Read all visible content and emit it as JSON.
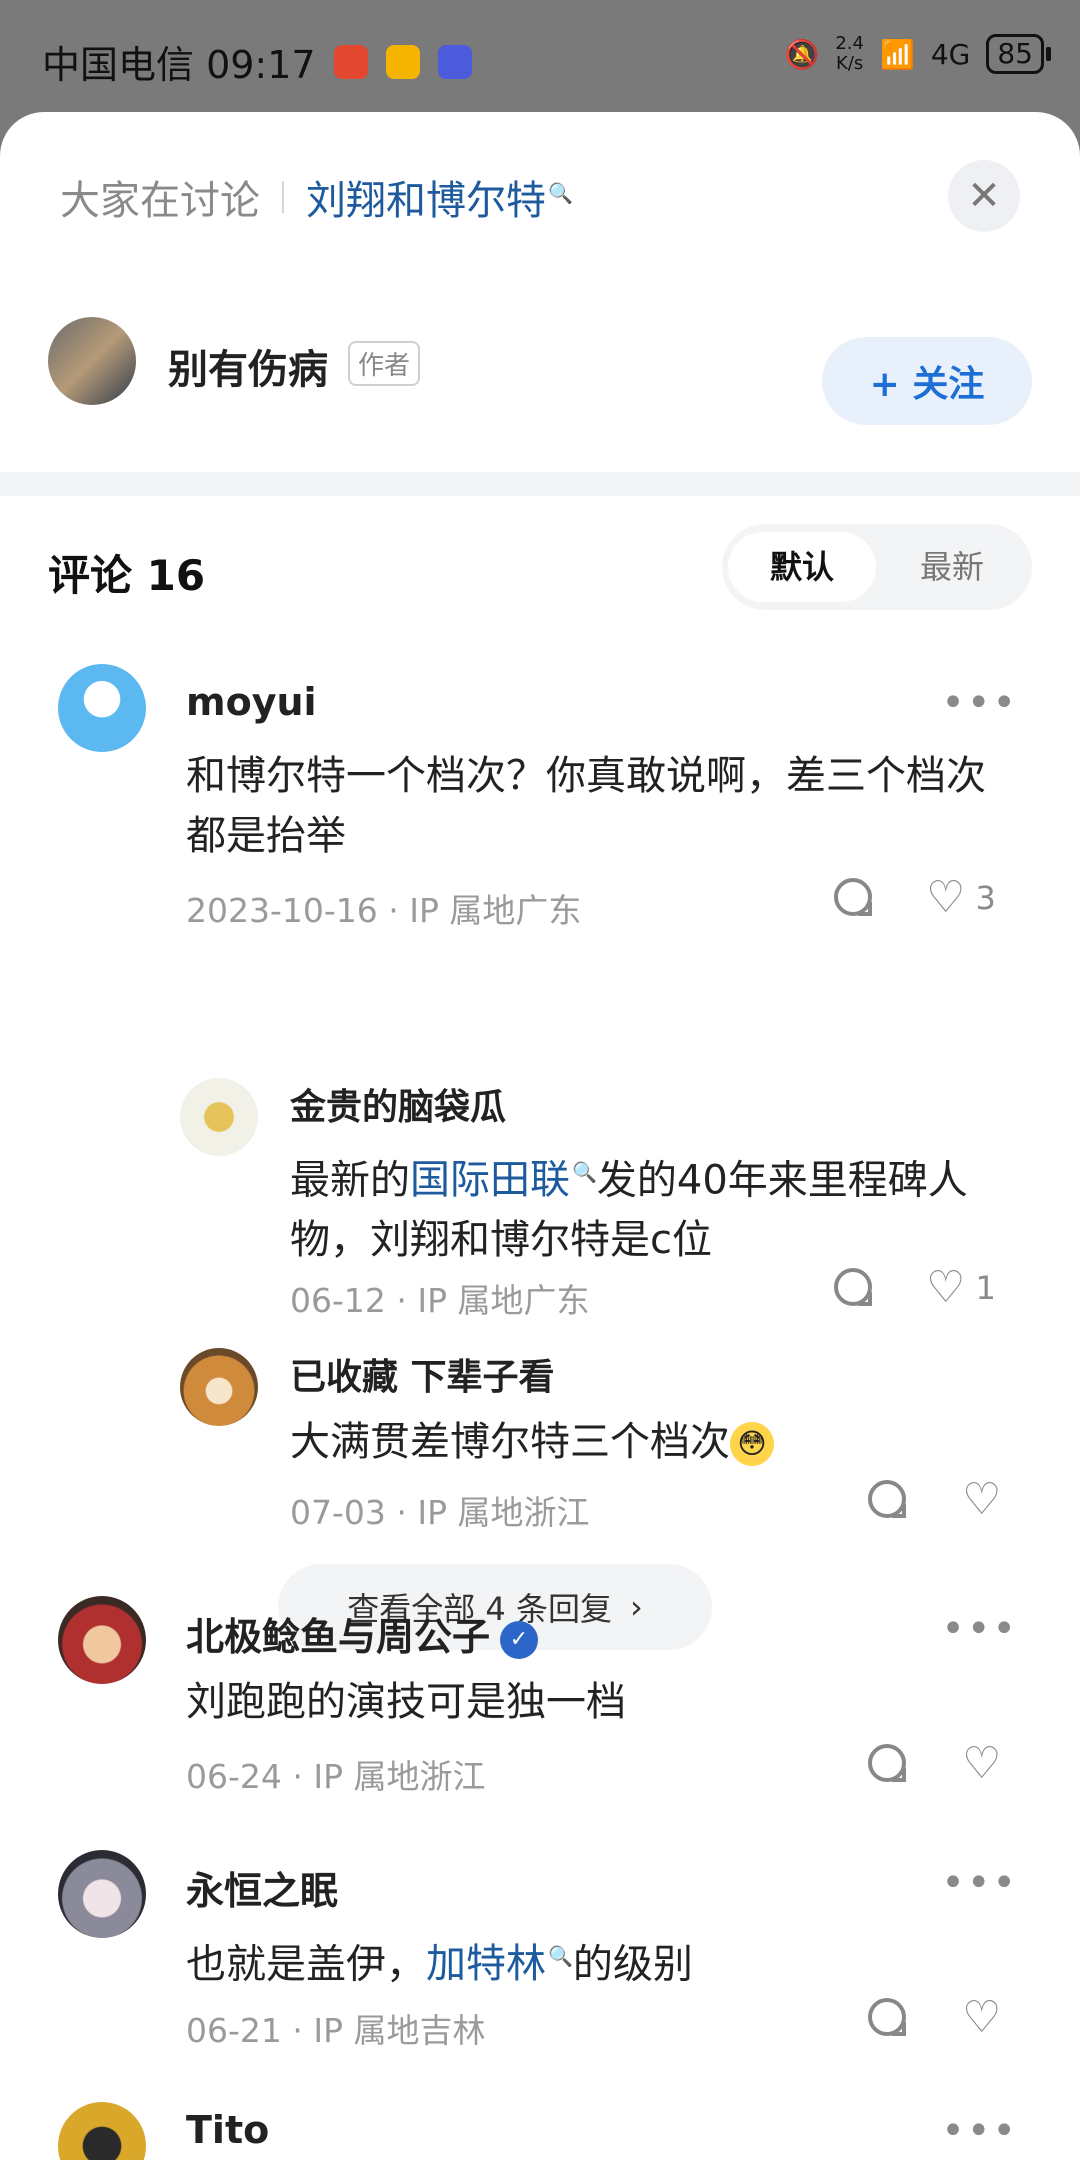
{
  "status_bar": {
    "carrier_time": "中国电信 09:17",
    "network_speed_value": "2.4",
    "network_speed_unit": "K/s",
    "network": "4G",
    "battery": "85"
  },
  "topic": {
    "prefix": "大家在讨论",
    "link": "刘翔和博尔特"
  },
  "author": {
    "name": "别有伤病",
    "badge": "作者",
    "follow_label": "+ 关注"
  },
  "comments_section": {
    "title": "评论 16",
    "sort_default": "默认",
    "sort_latest": "最新"
  },
  "comments": [
    {
      "name": "moyui",
      "text": "和博尔特一个档次？你真敢说啊，差三个档次都是抬举",
      "meta": "2023-10-16 · IP 属地广东",
      "likes": "3",
      "replies": [
        {
          "name": "金贵的脑袋瓜",
          "text_before": "最新的",
          "text_link": "国际田联",
          "text_after": "发的40年来里程碑人物，刘翔和博尔特是c位",
          "meta": "06-12 · IP 属地广东",
          "likes": "1"
        },
        {
          "name": "已收藏 下辈子看",
          "text": "大满贯差博尔特三个档次",
          "meta": "07-03 · IP 属地浙江",
          "likes": ""
        }
      ],
      "view_all": "查看全部 4 条回复"
    },
    {
      "name": "北极鲶鱼与周公子",
      "text": "刘跑跑的演技可是独一档",
      "meta": "06-24 · IP 属地浙江"
    },
    {
      "name": "永恒之眠",
      "text_before": "也就是盖伊，",
      "text_link": "加特林",
      "text_after": "的级别",
      "meta": "06-21 · IP 属地吉林"
    },
    {
      "name": "Tito"
    }
  ],
  "icons": {
    "more": "•••",
    "close": "✕",
    "chevron": "›",
    "heart": "♡",
    "search_sup": "ᵠ"
  }
}
